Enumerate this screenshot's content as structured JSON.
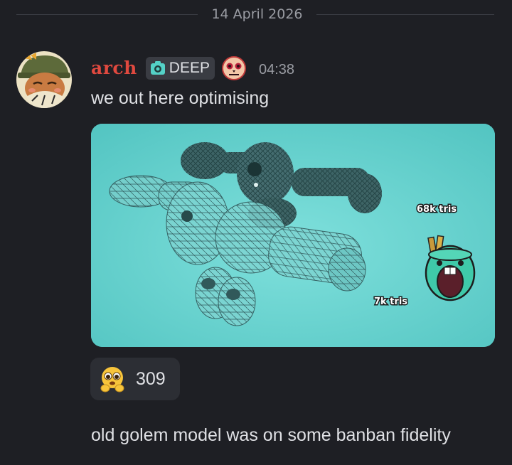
{
  "divider": {
    "date": "14 April 2026"
  },
  "message": {
    "author": "arch",
    "tag": {
      "icon": "camera-icon",
      "label": "DEEP"
    },
    "badge": {
      "icon": "skull-badge-icon"
    },
    "time": "04:38",
    "text": "we out here optimising",
    "attachment": {
      "labels": {
        "high_poly": "68k tris",
        "low_poly": "7k tris"
      }
    },
    "reaction": {
      "emoji": "pleading-face-emoji",
      "count": "309"
    }
  },
  "next_message": {
    "text": "old golem model was on some banban fidelity"
  },
  "colors": {
    "background": "#1e1f24",
    "username": "#e0493f",
    "text": "#dfe0e4",
    "muted": "#9a9ca3",
    "tag_bg": "#3a3c43",
    "reaction_bg": "#2c2e34",
    "attachment_bg": "#66d2cf"
  }
}
